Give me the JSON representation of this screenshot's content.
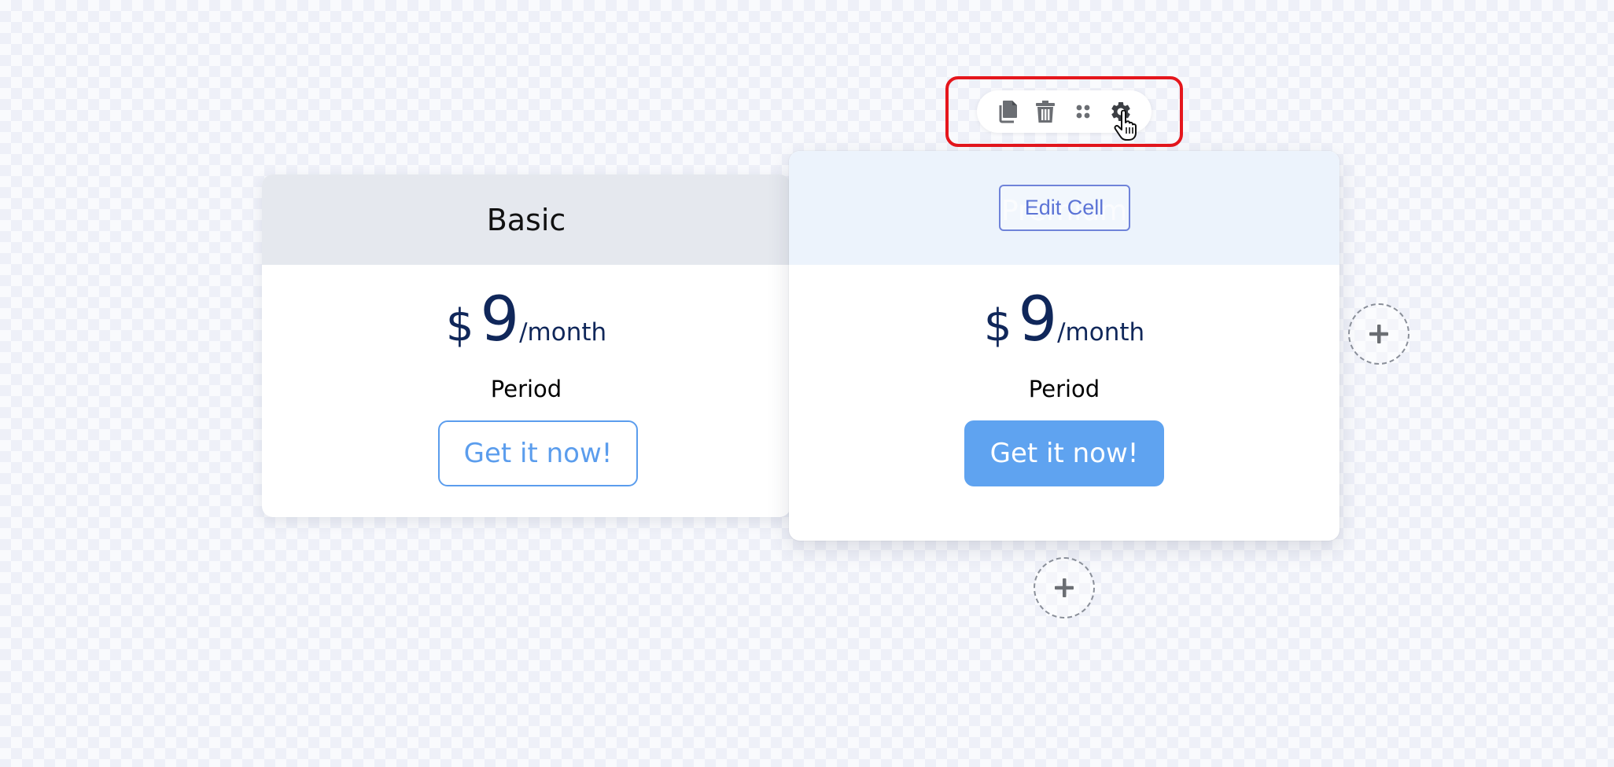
{
  "toolbar": {
    "buttons": [
      {
        "name": "copy-icon"
      },
      {
        "name": "trash-icon"
      },
      {
        "name": "drag-handle-icon"
      },
      {
        "name": "gear-icon"
      }
    ]
  },
  "cards": [
    {
      "header": "Basic",
      "currency": "$",
      "price": "9",
      "period_suffix": "/month",
      "period_label": "Period",
      "cta": "Get it now!"
    },
    {
      "header": "Premium",
      "edit_cell_label": "Edit Cell",
      "currency": "$",
      "price": "9",
      "period_suffix": "/month",
      "period_label": "Period",
      "cta": "Get it now!"
    }
  ],
  "colors": {
    "highlight": "#e5161c",
    "price_text": "#10275a",
    "accent": "#5fa3f0",
    "basic_header_bg": "#e5e8ee",
    "premium_header_bg": "#ecf3fc",
    "edit_cell": "#5c74d6"
  }
}
